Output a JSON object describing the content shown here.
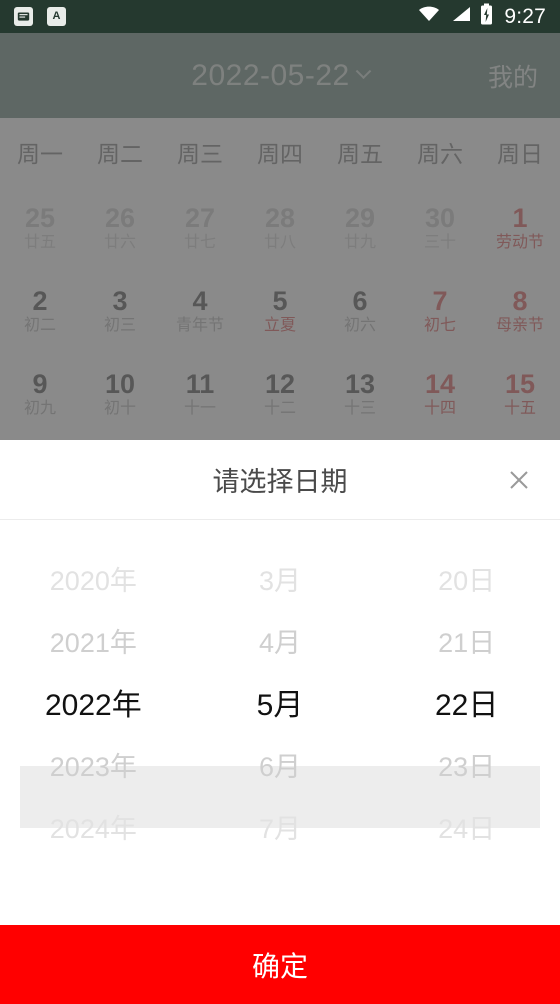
{
  "status_bar": {
    "icons_left": [
      "app-notification-icon",
      "keyboard-input-icon"
    ],
    "left_glyphs": [
      "☰",
      "A"
    ],
    "icons_right": [
      "wifi-icon",
      "cellular-signal-icon",
      "battery-charging-icon"
    ],
    "clock": "9:27",
    "background": "#25392f"
  },
  "calendar": {
    "header": {
      "date_label": "2022-05-22",
      "dropdown_icon": "chevron-down-icon",
      "mine_label": "我的",
      "background": "#3a6152"
    },
    "weekdays": [
      "周一",
      "周二",
      "周三",
      "周四",
      "周五",
      "周六",
      "周日"
    ],
    "weeks": [
      [
        {
          "num": "25",
          "sub": "廿五",
          "state": "out"
        },
        {
          "num": "26",
          "sub": "廿六",
          "state": "out"
        },
        {
          "num": "27",
          "sub": "廿七",
          "state": "out"
        },
        {
          "num": "28",
          "sub": "廿八",
          "state": "out"
        },
        {
          "num": "29",
          "sub": "廿九",
          "state": "out"
        },
        {
          "num": "30",
          "sub": "三十",
          "state": "out"
        },
        {
          "num": "1",
          "sub": "劳动节",
          "state": "red"
        }
      ],
      [
        {
          "num": "2",
          "sub": "初二",
          "state": "normal"
        },
        {
          "num": "3",
          "sub": "初三",
          "state": "normal"
        },
        {
          "num": "4",
          "sub": "青年节",
          "state": "normal"
        },
        {
          "num": "5",
          "sub": "立夏",
          "state": "red-sub"
        },
        {
          "num": "6",
          "sub": "初六",
          "state": "normal"
        },
        {
          "num": "7",
          "sub": "初七",
          "state": "red"
        },
        {
          "num": "8",
          "sub": "母亲节",
          "state": "red"
        }
      ],
      [
        {
          "num": "9",
          "sub": "初九",
          "state": "normal"
        },
        {
          "num": "10",
          "sub": "初十",
          "state": "normal"
        },
        {
          "num": "11",
          "sub": "十一",
          "state": "normal"
        },
        {
          "num": "12",
          "sub": "十二",
          "state": "normal"
        },
        {
          "num": "13",
          "sub": "十三",
          "state": "normal"
        },
        {
          "num": "14",
          "sub": "十四",
          "state": "red"
        },
        {
          "num": "15",
          "sub": "十五",
          "state": "red"
        }
      ]
    ]
  },
  "sheet": {
    "title": "请选择日期",
    "close_icon": "close-icon",
    "picker": {
      "year_column": [
        {
          "label": "2020年",
          "selected": false
        },
        {
          "label": "2021年",
          "selected": false
        },
        {
          "label": "2022年",
          "selected": true
        },
        {
          "label": "2023年",
          "selected": false
        },
        {
          "label": "2024年",
          "selected": false
        }
      ],
      "month_column": [
        {
          "label": "3月",
          "selected": false
        },
        {
          "label": "4月",
          "selected": false
        },
        {
          "label": "5月",
          "selected": true
        },
        {
          "label": "6月",
          "selected": false
        },
        {
          "label": "7月",
          "selected": false
        }
      ],
      "day_column": [
        {
          "label": "20日",
          "selected": false
        },
        {
          "label": "21日",
          "selected": false
        },
        {
          "label": "22日",
          "selected": true
        },
        {
          "label": "23日",
          "selected": false
        },
        {
          "label": "24日",
          "selected": false
        }
      ],
      "selected_value": "2022年 5月 22日"
    },
    "confirm_label": "确定",
    "confirm_color": "#ff0000"
  }
}
